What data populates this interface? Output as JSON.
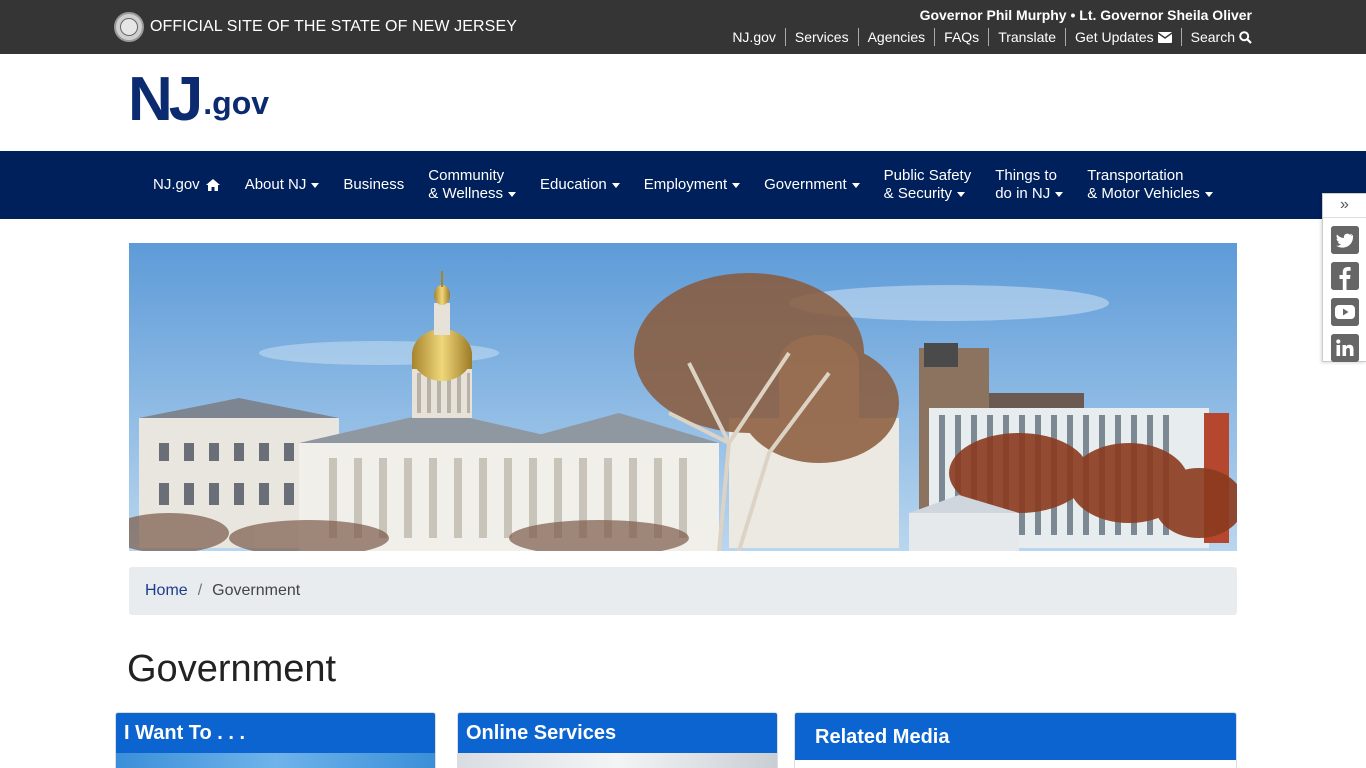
{
  "topbar": {
    "official_text": "OFFICIAL SITE OF THE STATE OF NEW JERSEY",
    "governor_text": "Governor Phil Murphy • Lt. Governor Sheila Oliver",
    "links": [
      {
        "label": "NJ.gov"
      },
      {
        "label": "Services"
      },
      {
        "label": "Agencies"
      },
      {
        "label": "FAQs"
      },
      {
        "label": "Translate"
      },
      {
        "label": "Get Updates",
        "icon": "envelope-icon"
      },
      {
        "label": "Search",
        "icon": "search-icon"
      }
    ]
  },
  "logo": {
    "nj": "NJ",
    "gov": ".gov"
  },
  "nav": {
    "items": [
      {
        "line1": "NJ.gov",
        "line2": "",
        "icon": "home-icon"
      },
      {
        "line1": "About NJ",
        "line2": "",
        "dropdown": true
      },
      {
        "line1": "Business",
        "line2": ""
      },
      {
        "line1": "Community",
        "line2": "& Wellness",
        "dropdown": true
      },
      {
        "line1": "Education",
        "line2": "",
        "dropdown": true
      },
      {
        "line1": "Employment",
        "line2": "",
        "dropdown": true
      },
      {
        "line1": "Government",
        "line2": "",
        "dropdown": true
      },
      {
        "line1": "Public Safety",
        "line2": "& Security",
        "dropdown": true
      },
      {
        "line1": "Things to",
        "line2": "do in NJ",
        "dropdown": true
      },
      {
        "line1": "Transportation",
        "line2": "& Motor Vehicles",
        "dropdown": true
      }
    ]
  },
  "social": {
    "toggle": "»",
    "icons": [
      "twitter-icon",
      "facebook-icon",
      "youtube-icon",
      "linkedin-icon"
    ]
  },
  "breadcrumb": {
    "home": "Home",
    "separator": "/",
    "current": "Government"
  },
  "page_title": "Government",
  "cards": [
    {
      "title": "I Want To . . ."
    },
    {
      "title": "Online Services"
    },
    {
      "title": "Related Media"
    }
  ],
  "colors": {
    "topbar": "#353535",
    "nav": "#00205b",
    "logo": "#0b2a6f",
    "card_header": "#0b64d0",
    "breadcrumb_bg": "#e9ecef"
  }
}
